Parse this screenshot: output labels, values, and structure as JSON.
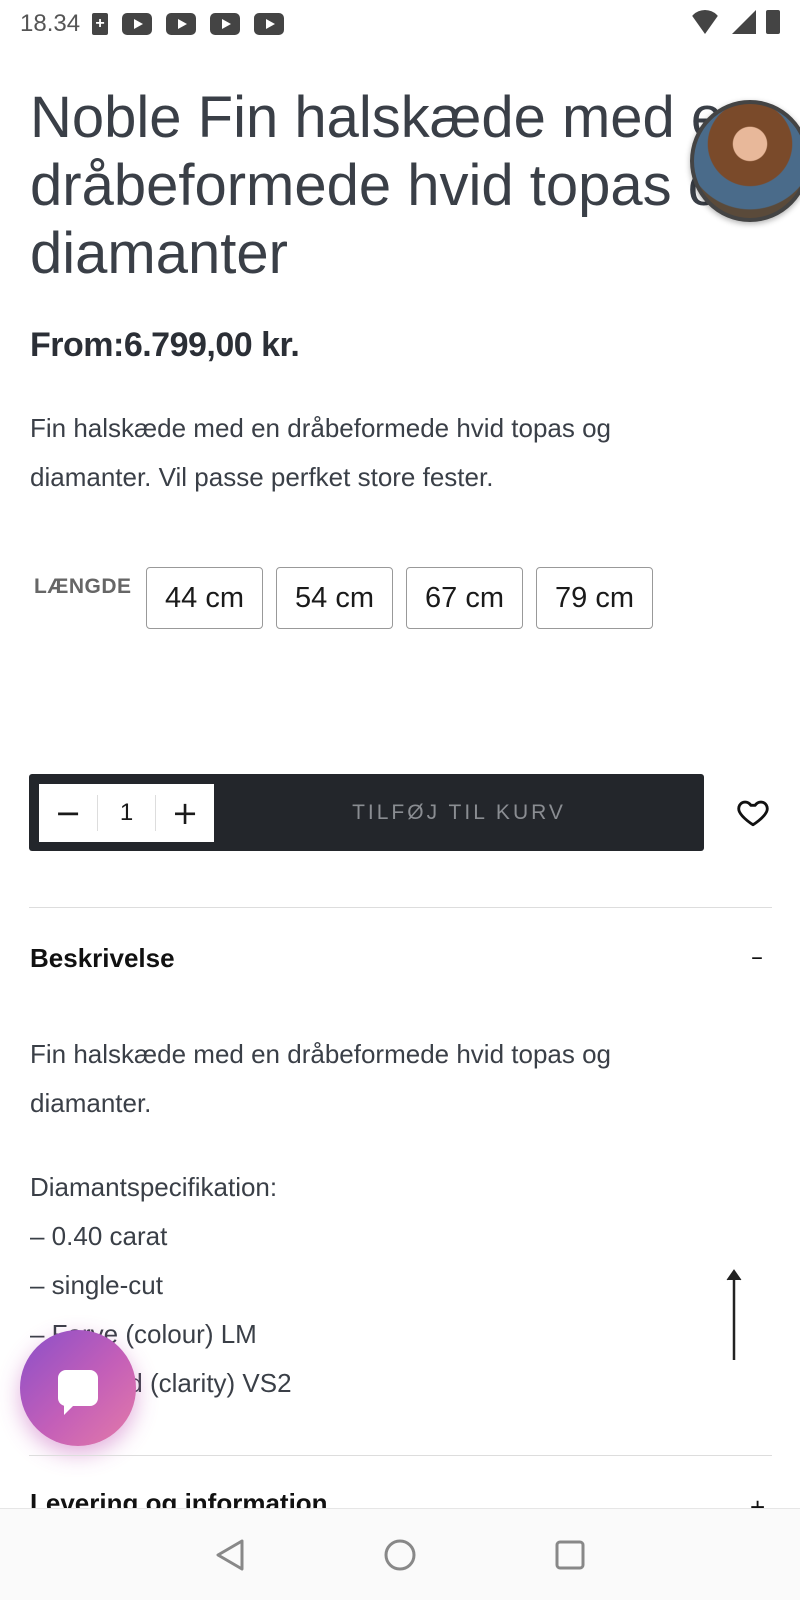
{
  "status_bar": {
    "time": "18.34",
    "left_icons": [
      "battery-saver-icon",
      "youtube-icon",
      "youtube-icon",
      "youtube-icon",
      "youtube-icon"
    ],
    "right_icons": [
      "wifi-icon",
      "cell-signal-icon",
      "battery-icon"
    ]
  },
  "product": {
    "title": "Noble Fin halskæde med en\ndråbeformede hvid topas og\ndiamanter",
    "price": "From:6.799,00 kr.",
    "short_description": "Fin halskæde med en dråbeformede hvid topas og diamanter. Vil passe perfket store fester."
  },
  "length": {
    "label": "LÆNGDE",
    "options": [
      "44 cm",
      "54 cm",
      "67 cm",
      "79 cm"
    ]
  },
  "cart": {
    "minus": "−",
    "quantity": "1",
    "plus": "+",
    "add_label": "TILFØJ TIL KURV"
  },
  "sections": {
    "description": {
      "title": "Beskrivelse",
      "toggle": "–",
      "intro": "Fin halskæde med en dråbeformede hvid topas og\ndiamanter.",
      "specs": "Diamantspecifikation:\n– 0.40 carat\n– single-cut\n– Farve (colour) LM\n– Renhed (clarity) VS2"
    },
    "shipping": {
      "title": "Levering og information",
      "toggle": "+"
    }
  },
  "colors": {
    "cart_bar": "#23262b",
    "chat_gradient_start": "#8a4fc9",
    "chat_gradient_end": "#e47ba8"
  }
}
